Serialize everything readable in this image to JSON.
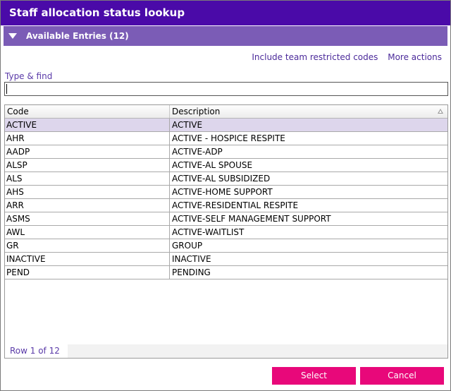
{
  "window": {
    "title": "Staff allocation status lookup"
  },
  "section": {
    "label": "Available Entries (12)"
  },
  "links": {
    "include_team": "Include team restricted codes",
    "more_actions": "More actions"
  },
  "search": {
    "label": "Type & find",
    "value": "",
    "placeholder": ""
  },
  "grid": {
    "columns": [
      "Code",
      "Description"
    ],
    "rows": [
      {
        "code": "ACTIVE",
        "description": "ACTIVE"
      },
      {
        "code": "AHR",
        "description": "ACTIVE - HOSPICE RESPITE"
      },
      {
        "code": "AADP",
        "description": "ACTIVE-ADP"
      },
      {
        "code": "ALSP",
        "description": "ACTIVE-AL SPOUSE"
      },
      {
        "code": "ALS",
        "description": "ACTIVE-AL SUBSIDIZED"
      },
      {
        "code": "AHS",
        "description": "ACTIVE-HOME SUPPORT"
      },
      {
        "code": "ARR",
        "description": "ACTIVE-RESIDENTIAL RESPITE"
      },
      {
        "code": "ASMS",
        "description": "ACTIVE-SELF MANAGEMENT SUPPORT"
      },
      {
        "code": "AWL",
        "description": "ACTIVE-WAITLIST"
      },
      {
        "code": "GR",
        "description": "GROUP"
      },
      {
        "code": "INACTIVE",
        "description": "INACTIVE"
      },
      {
        "code": "PEND",
        "description": "PENDING"
      }
    ],
    "selected_index": 0,
    "sort_icon": "sort-ascending-icon",
    "row_status": "Row 1 of 12"
  },
  "buttons": {
    "select": "Select",
    "cancel": "Cancel"
  },
  "colors": {
    "title_bar": "#4a0aa8",
    "section_bar": "#7b5cb6",
    "accent_button": "#e8087a",
    "selected_row": "#ddd6ec"
  }
}
